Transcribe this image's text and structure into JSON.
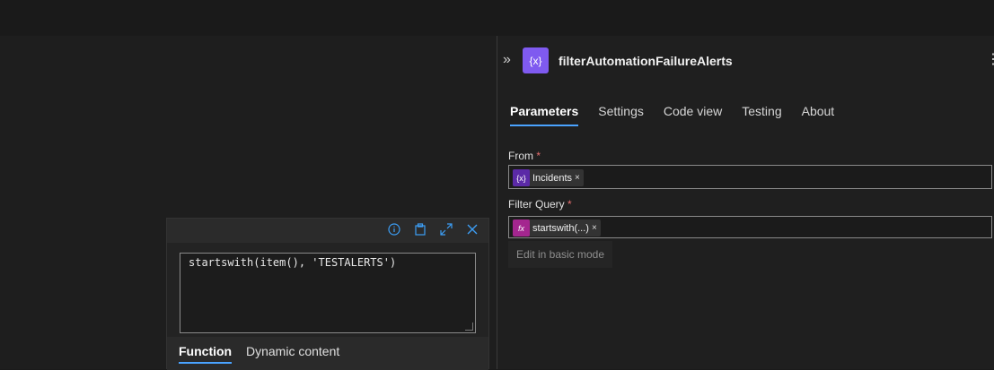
{
  "panel": {
    "title": "filterAutomationFailureAlerts",
    "action_icon": "{x}",
    "tabs": [
      "Parameters",
      "Settings",
      "Code view",
      "Testing",
      "About"
    ],
    "from": {
      "label": "From",
      "required": "*",
      "token": {
        "icon": "{x}",
        "text": "Incidents",
        "close": "×",
        "color": "#5b2aa7"
      }
    },
    "filter_query": {
      "label": "Filter Query",
      "required": "*",
      "token": {
        "icon": "fx",
        "text": "startswith(...)",
        "close": "×",
        "color": "#a4268f"
      }
    },
    "basic_mode_label": "Edit in basic mode"
  },
  "popup": {
    "expression": "startswith(item(), 'TESTALERTS')",
    "tabs": [
      "Function",
      "Dynamic content"
    ],
    "icons": [
      "info-icon",
      "clipboard-icon",
      "expand-icon",
      "close-icon"
    ]
  },
  "colors": {
    "accent": "#4aa3ff",
    "action_icon_bg": "#7f5af0"
  }
}
